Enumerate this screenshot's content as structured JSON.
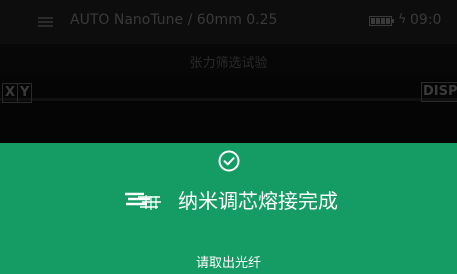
{
  "status_bar": {
    "menu_icon": "hamburger-menu-icon",
    "mode_title": "AUTO NanoTune / 60mm 0.25",
    "battery_icon": "battery-icon",
    "charge_icon": "lightning-icon",
    "charge_symbol": "ϟ",
    "time": "09:0"
  },
  "sub_title": "张力筛选试验",
  "fiber_view": {
    "x_label": "X",
    "y_label": "Y",
    "disp_label": "DISP"
  },
  "completion": {
    "check_icon": "check-circle-icon",
    "fusion_icon": "fiber-fusion-icon",
    "message": "纳米调芯熔接完成",
    "hint": "请取出光纤",
    "panel_color": "#159b64",
    "text_color": "#ffffff"
  }
}
